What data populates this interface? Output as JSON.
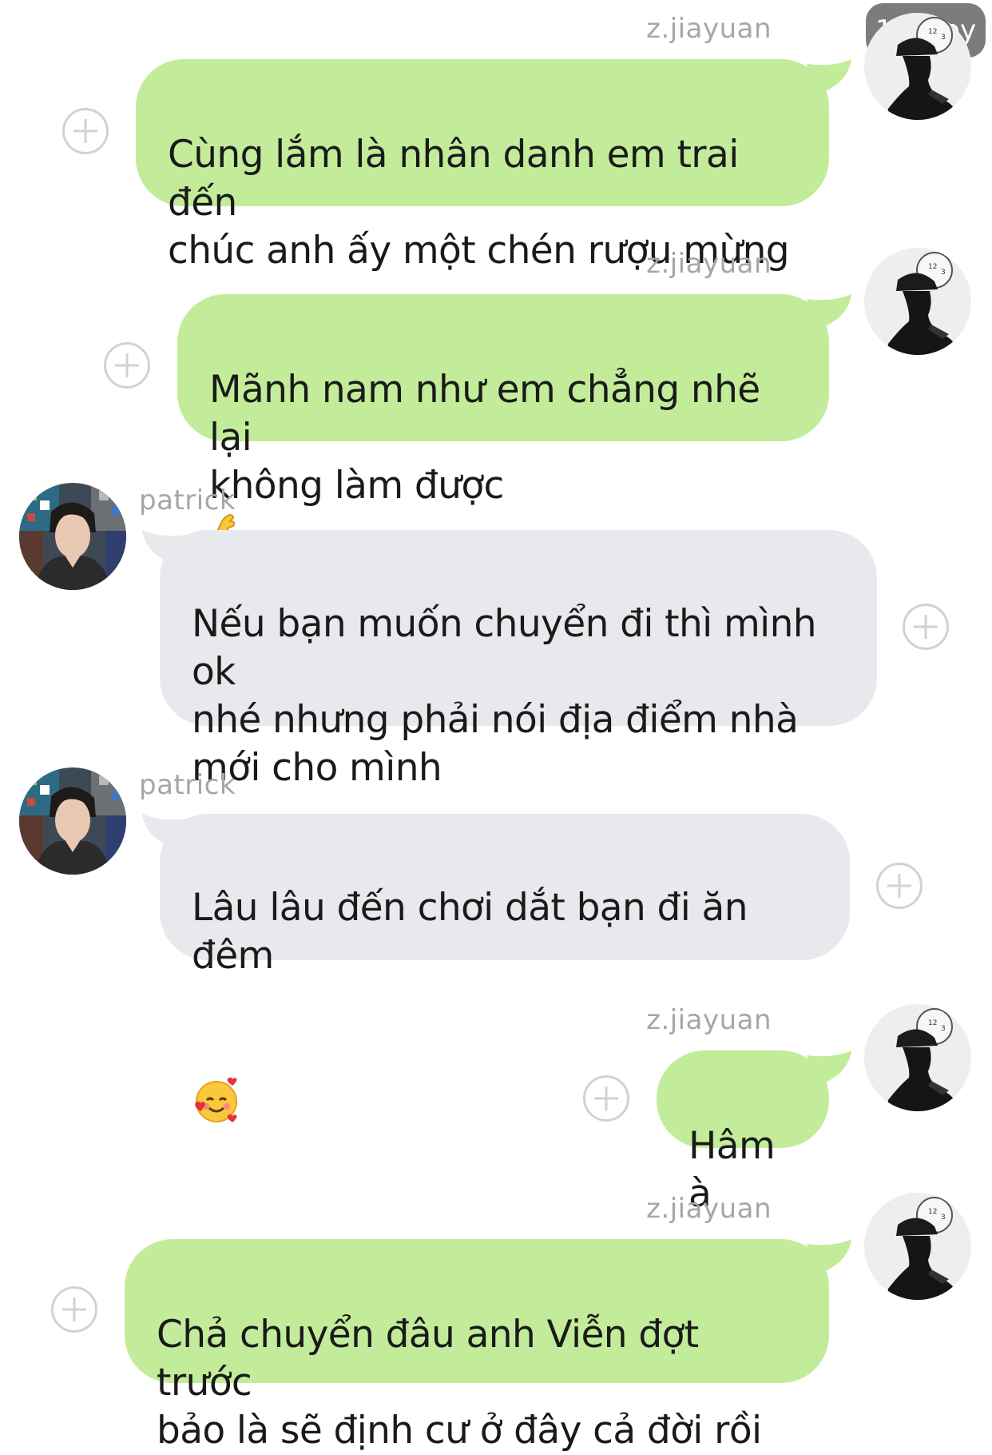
{
  "badge": {
    "text": "110 joy"
  },
  "messages": [
    {
      "sender": "z.jiayuan",
      "side": "right",
      "avatar": "silhouette-hat-avatar",
      "text": "Cùng lắm là nhân danh em trai đến\nchúc anh ấy một chén rượu mừng",
      "emoji": ""
    },
    {
      "sender": "z.jiayuan",
      "side": "right",
      "avatar": "silhouette-hat-avatar",
      "text": "Mãnh nam như em chẳng nhẽ lại\nkhông làm được",
      "emoji": "flexed-biceps"
    },
    {
      "sender": "patrick",
      "side": "left",
      "avatar": "young-man-photo-avatar",
      "text": "Nếu bạn muốn chuyển đi thì mình ok\nnhé nhưng phải nói địa điểm nhà\nmới cho mình",
      "emoji": ""
    },
    {
      "sender": "patrick",
      "side": "left",
      "avatar": "young-man-photo-avatar",
      "text": "Lâu lâu đến chơi dắt bạn đi ăn đêm",
      "emoji": "smiling-face-with-hearts"
    },
    {
      "sender": "z.jiayuan",
      "side": "right",
      "avatar": "silhouette-hat-avatar",
      "text": "Hâm à",
      "emoji": ""
    },
    {
      "sender": "z.jiayuan",
      "side": "right",
      "avatar": "silhouette-hat-avatar",
      "text": "Chả chuyển đâu anh Viễn đợt trước\nbảo là sẽ định cư ở đây cả đời rồi",
      "emoji": ""
    }
  ],
  "colors": {
    "outgoing_bubble": "#c3ec9a",
    "incoming_bubble": "#e7e9ec",
    "username": "#a6a6a6",
    "plus_icon": "#d2d2d2",
    "background": "#ffffff"
  }
}
